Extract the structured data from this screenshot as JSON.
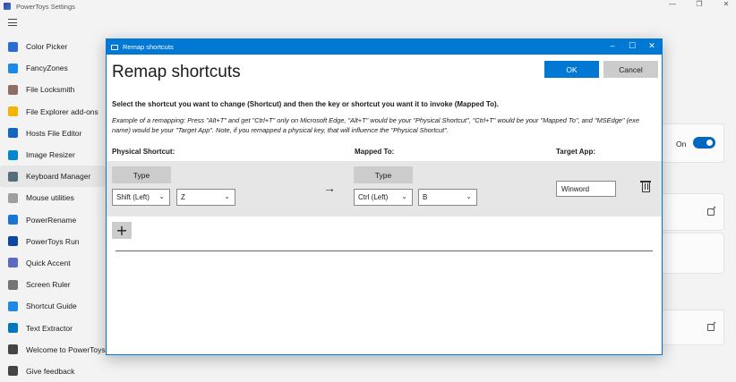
{
  "window": {
    "title": "PowerToys Settings",
    "controls": [
      "—",
      "❐",
      "✕"
    ]
  },
  "sidebar": {
    "items": [
      {
        "label": "Color Picker",
        "icon": "color-picker-icon",
        "color": "#2b6cd4"
      },
      {
        "label": "FancyZones",
        "icon": "fancyzones-icon",
        "color": "#1e88e5"
      },
      {
        "label": "File Locksmith",
        "icon": "lock-icon",
        "color": "#8d6e63"
      },
      {
        "label": "File Explorer add-ons",
        "icon": "folder-icon",
        "color": "#f4b400"
      },
      {
        "label": "Hosts File Editor",
        "icon": "hosts-icon",
        "color": "#1565c0"
      },
      {
        "label": "Image Resizer",
        "icon": "image-icon",
        "color": "#0288d1"
      },
      {
        "label": "Keyboard Manager",
        "icon": "keyboard-icon",
        "color": "#546e7a"
      },
      {
        "label": "Mouse utilities",
        "icon": "mouse-icon",
        "color": "#9e9e9e"
      },
      {
        "label": "PowerRename",
        "icon": "rename-icon",
        "color": "#1976d2"
      },
      {
        "label": "PowerToys Run",
        "icon": "run-icon",
        "color": "#0d47a1"
      },
      {
        "label": "Quick Accent",
        "icon": "accent-icon",
        "color": "#5c6bc0"
      },
      {
        "label": "Screen Ruler",
        "icon": "ruler-icon",
        "color": "#757575"
      },
      {
        "label": "Shortcut Guide",
        "icon": "shortcut-guide-icon",
        "color": "#1e88e5"
      },
      {
        "label": "Text Extractor",
        "icon": "text-extractor-icon",
        "color": "#0277bd"
      },
      {
        "label": "Welcome to PowerToys",
        "icon": "welcome-icon",
        "color": "#444444"
      },
      {
        "label": "Give feedback",
        "icon": "feedback-icon",
        "color": "#444444"
      }
    ],
    "active_index": 6
  },
  "background": {
    "toggle_label": "On"
  },
  "dialog": {
    "title": "Remap shortcuts",
    "heading": "Remap shortcuts",
    "ok_label": "OK",
    "cancel_label": "Cancel",
    "instructions": "Select the shortcut you want to change (Shortcut) and then the key or shortcut you want it to invoke (Mapped To).",
    "example": "Example of a remapping: Press \"Alt+T\" and get \"Ctrl+T\" only on Microsoft Edge, \"Alt+T\" would be your \"Physical Shortcut\", \"Ctrl+T\" would be your \"Mapped To\", and \"MSEdge\" (exe name) would be your \"Target App\". Note, if you remapped a physical key, that will influence the \"Physical Shortcut\".",
    "headers": {
      "physical": "Physical Shortcut:",
      "mapped": "Mapped To:",
      "target": "Target App:"
    },
    "row": {
      "physical_type_label": "Type",
      "physical_modifier": "Shift (Left)",
      "physical_key": "Z",
      "arrow": "→",
      "mapped_type_label": "Type",
      "mapped_modifier": "Ctrl (Left)",
      "mapped_key": "B",
      "target_app": "Winword"
    },
    "add_label": "+",
    "accent_color": "#0078d4"
  }
}
